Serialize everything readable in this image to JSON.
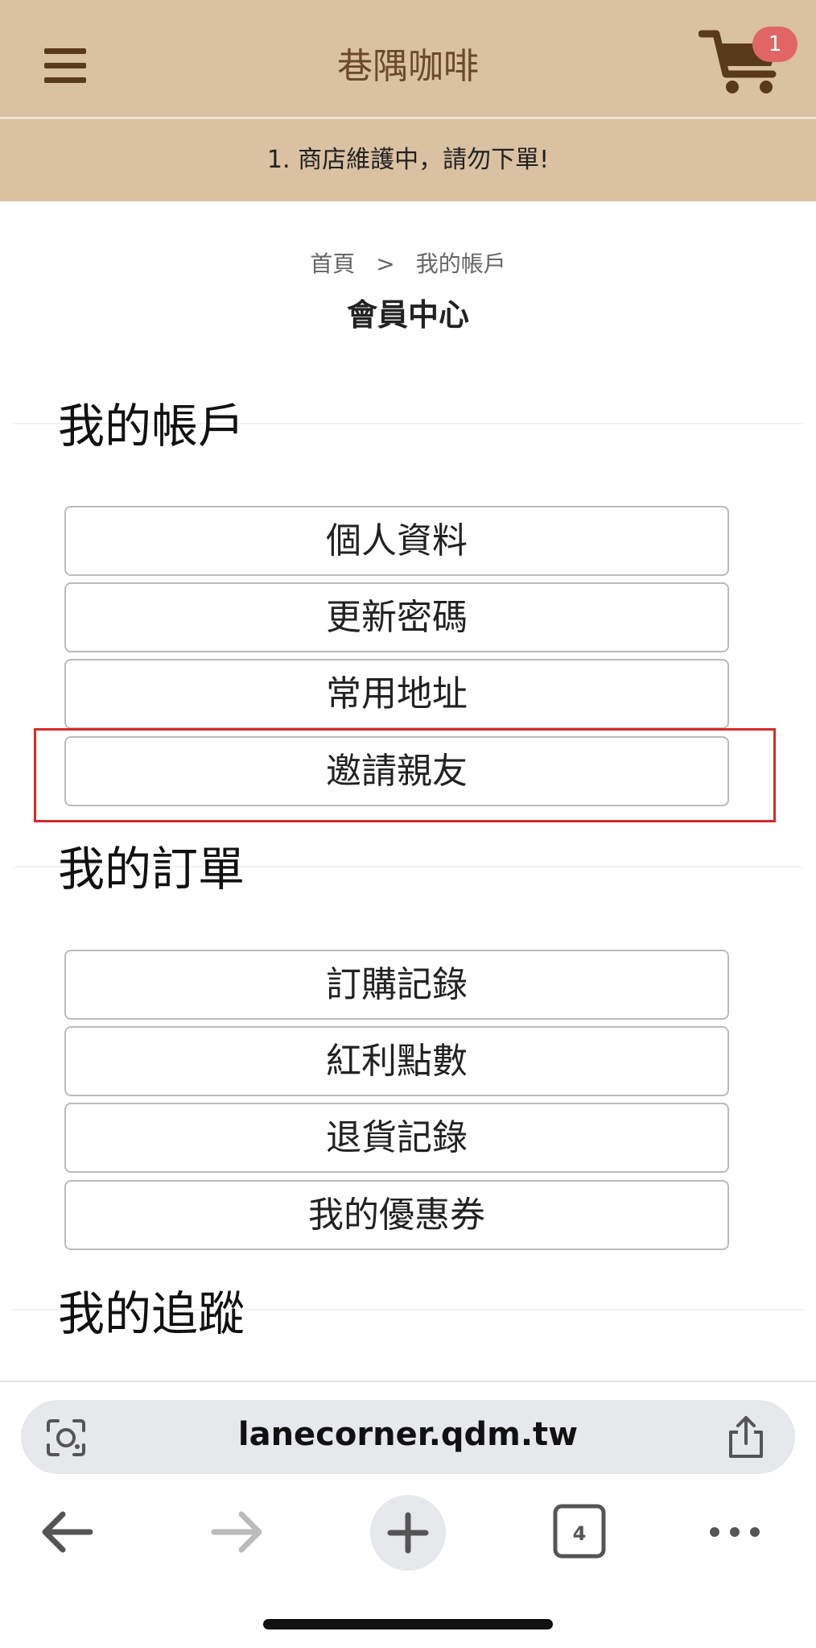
{
  "header": {
    "title": "巷隅咖啡",
    "cart_count": "1",
    "menu_icon": "hamburger-menu-icon",
    "cart_icon": "shopping-cart-icon"
  },
  "notice": "1. 商店維護中，請勿下單!",
  "breadcrumb": {
    "home": "首頁",
    "separator": ">",
    "current": "我的帳戶"
  },
  "page_title": "會員中心",
  "sections": {
    "account": {
      "heading": "我的帳戶",
      "items": [
        "個人資料",
        "更新密碼",
        "常用地址",
        "邀請親友"
      ]
    },
    "orders": {
      "heading": "我的訂單",
      "items": [
        "訂購記錄",
        "紅利點數",
        "退貨記錄",
        "我的優惠券"
      ]
    },
    "tracking": {
      "heading": "我的追蹤"
    }
  },
  "browser": {
    "url": "lanecorner.qdm.tw",
    "tab_count": "4"
  },
  "colors": {
    "header_bg": "#d9c1a2",
    "brand_brown": "#6b4a2b",
    "badge_red": "#e06666",
    "highlight_red": "#d62b2b"
  }
}
